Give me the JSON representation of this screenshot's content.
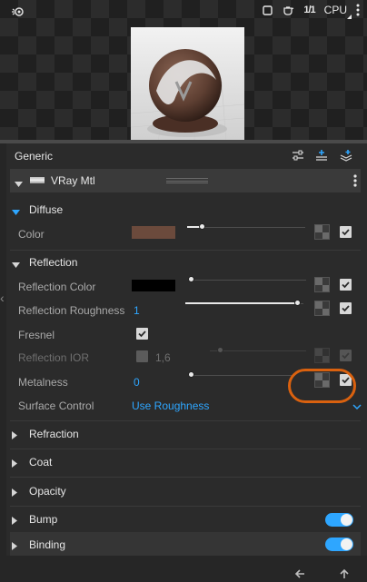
{
  "toolbar": {
    "aspect_value": "1/1",
    "render_device": "CPU",
    "icons": [
      "wand-icon",
      "square-icon",
      "teapot-icon",
      "kebab-menu-icon"
    ]
  },
  "panel": {
    "title": "Generic",
    "material_name": "VRay Mtl"
  },
  "sections": {
    "diffuse": "Diffuse",
    "reflection": "Reflection",
    "refraction": "Refraction",
    "coat": "Coat",
    "opacity": "Opacity",
    "bump": "Bump",
    "binding": "Binding"
  },
  "diffuse": {
    "color_label": "Color",
    "color_value": "#6b4a3c",
    "color_slider": 0.12
  },
  "reflection": {
    "reflection_color_label": "Reflection Color",
    "reflection_color_value": "#000000",
    "reflection_color_slider": 0.0,
    "roughness_label": "Reflection Roughness",
    "roughness_value": "1",
    "fresnel_label": "Fresnel",
    "fresnel_checked": true,
    "ior_label": "Reflection IOR",
    "ior_value": "1,6",
    "metalness_label": "Metalness",
    "metalness_value": "0",
    "surface_control_label": "Surface Control",
    "surface_control_value": "Use Roughness"
  },
  "toggles": {
    "bump_enabled": true,
    "binding_enabled": true
  },
  "colors": {
    "accent": "#2ea6ff",
    "highlight": "#d9610f"
  }
}
